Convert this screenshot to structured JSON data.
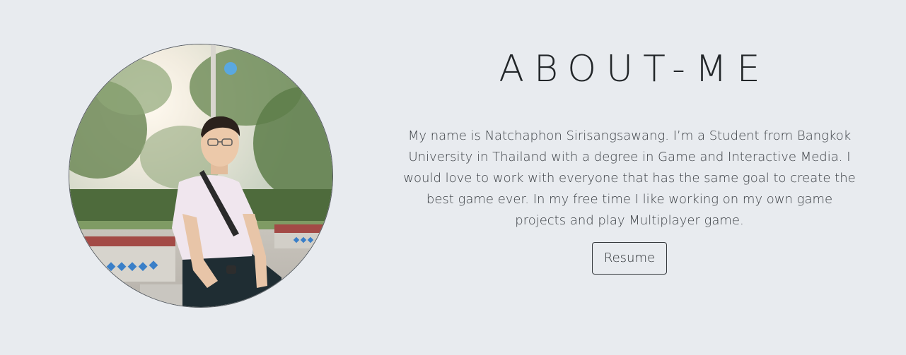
{
  "about": {
    "title": "ABOUT-ME",
    "bio": "My name is Natchaphon Sirisangsawang. I’m a Student from Bangkok University in Thailand with a degree in Game and Interactive Media. I would love to work with everyone that has the same goal to create the best game ever. In my free time I like working on my own game projects and play Multiplayer game.",
    "resume_label": "Resume"
  },
  "colors": {
    "background": "#e8ebef",
    "text": "#222629",
    "button_border": "#34383c"
  }
}
